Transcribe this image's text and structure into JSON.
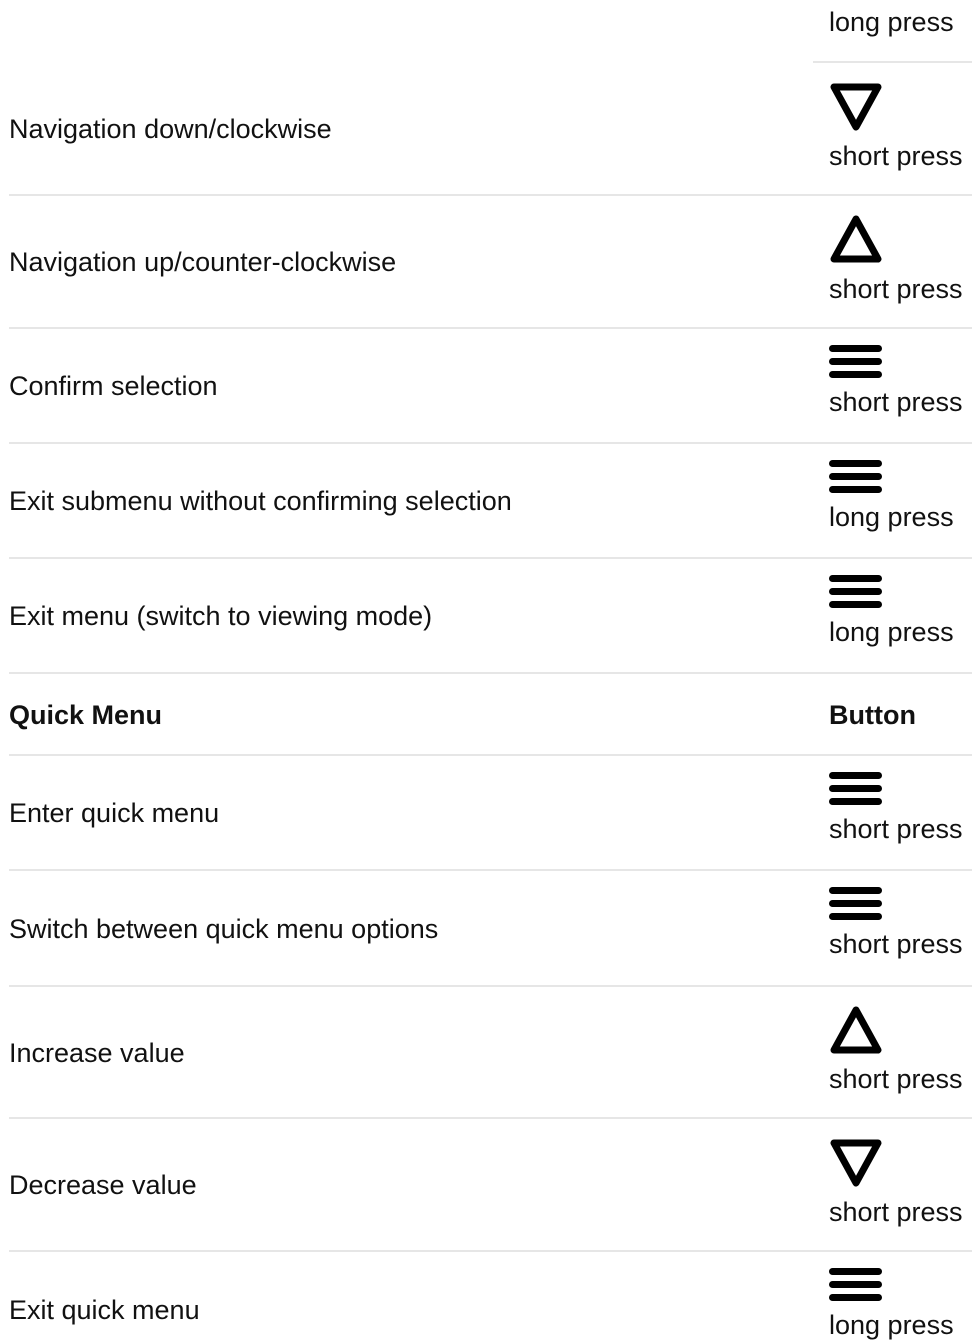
{
  "top_partial": {
    "press": "long press"
  },
  "rows": [
    {
      "label": "Navigation down/clockwise",
      "icon": "triangle-down-icon",
      "press": "short press"
    },
    {
      "label": "Navigation up/counter-clockwise",
      "icon": "triangle-up-icon",
      "press": "short press"
    },
    {
      "label": "Confirm selection",
      "icon": "menu-bars-icon",
      "press": "short press"
    },
    {
      "label": "Exit submenu without confirming selection",
      "icon": "menu-bars-icon",
      "press": "long press"
    },
    {
      "label": "Exit menu (switch to viewing mode)",
      "icon": "menu-bars-icon",
      "press": "long press"
    }
  ],
  "quick_menu_header": {
    "label": "Quick Menu",
    "column": "Button"
  },
  "quick_rows": [
    {
      "label": "Enter quick menu",
      "icon": "menu-bars-icon",
      "press": "short press"
    },
    {
      "label": "Switch between quick menu options",
      "icon": "menu-bars-icon",
      "press": "short press"
    },
    {
      "label": "Increase value",
      "icon": "triangle-up-icon",
      "press": "short press"
    },
    {
      "label": "Decrease value",
      "icon": "triangle-down-icon",
      "press": "short press"
    },
    {
      "label": "Exit quick menu",
      "icon": "menu-bars-icon",
      "press": "long press"
    }
  ]
}
